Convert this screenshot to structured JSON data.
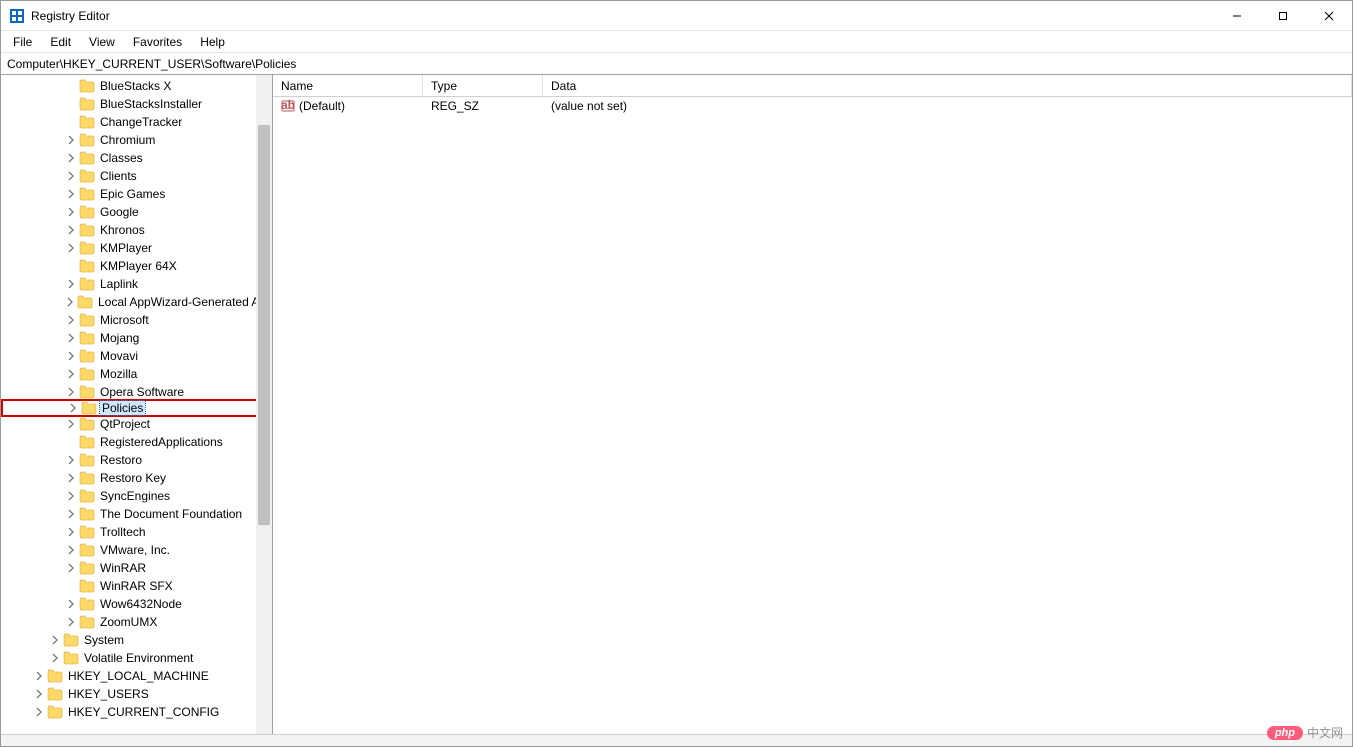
{
  "window": {
    "title": "Registry Editor"
  },
  "menu": {
    "file": "File",
    "edit": "Edit",
    "view": "View",
    "favorites": "Favorites",
    "help": "Help"
  },
  "address": "Computer\\HKEY_CURRENT_USER\\Software\\Policies",
  "tree": {
    "items": [
      {
        "indent": 4,
        "chev": "none",
        "label": "BlueStacks X"
      },
      {
        "indent": 4,
        "chev": "none",
        "label": "BlueStacksInstaller"
      },
      {
        "indent": 4,
        "chev": "none",
        "label": "ChangeTracker"
      },
      {
        "indent": 4,
        "chev": "right",
        "label": "Chromium"
      },
      {
        "indent": 4,
        "chev": "right",
        "label": "Classes"
      },
      {
        "indent": 4,
        "chev": "right",
        "label": "Clients"
      },
      {
        "indent": 4,
        "chev": "right",
        "label": "Epic Games"
      },
      {
        "indent": 4,
        "chev": "right",
        "label": "Google"
      },
      {
        "indent": 4,
        "chev": "right",
        "label": "Khronos"
      },
      {
        "indent": 4,
        "chev": "right",
        "label": "KMPlayer"
      },
      {
        "indent": 4,
        "chev": "none",
        "label": "KMPlayer 64X"
      },
      {
        "indent": 4,
        "chev": "right",
        "label": "Laplink"
      },
      {
        "indent": 4,
        "chev": "right",
        "label": "Local AppWizard-Generated Applications"
      },
      {
        "indent": 4,
        "chev": "right",
        "label": "Microsoft"
      },
      {
        "indent": 4,
        "chev": "right",
        "label": "Mojang"
      },
      {
        "indent": 4,
        "chev": "right",
        "label": "Movavi"
      },
      {
        "indent": 4,
        "chev": "right",
        "label": "Mozilla"
      },
      {
        "indent": 4,
        "chev": "right",
        "label": "Opera Software"
      },
      {
        "indent": 4,
        "chev": "right",
        "label": "Policies",
        "selected": true,
        "highlighted": true
      },
      {
        "indent": 4,
        "chev": "right",
        "label": "QtProject"
      },
      {
        "indent": 4,
        "chev": "none",
        "label": "RegisteredApplications"
      },
      {
        "indent": 4,
        "chev": "right",
        "label": "Restoro"
      },
      {
        "indent": 4,
        "chev": "right",
        "label": "Restoro Key"
      },
      {
        "indent": 4,
        "chev": "right",
        "label": "SyncEngines"
      },
      {
        "indent": 4,
        "chev": "right",
        "label": "The Document Foundation"
      },
      {
        "indent": 4,
        "chev": "right",
        "label": "Trolltech"
      },
      {
        "indent": 4,
        "chev": "right",
        "label": "VMware, Inc."
      },
      {
        "indent": 4,
        "chev": "right",
        "label": "WinRAR"
      },
      {
        "indent": 4,
        "chev": "none",
        "label": "WinRAR SFX"
      },
      {
        "indent": 4,
        "chev": "right",
        "label": "Wow6432Node"
      },
      {
        "indent": 4,
        "chev": "right",
        "label": "ZoomUMX"
      },
      {
        "indent": 3,
        "chev": "right",
        "label": "System"
      },
      {
        "indent": 3,
        "chev": "right",
        "label": "Volatile Environment"
      },
      {
        "indent": 2,
        "chev": "right",
        "label": "HKEY_LOCAL_MACHINE"
      },
      {
        "indent": 2,
        "chev": "right",
        "label": "HKEY_USERS"
      },
      {
        "indent": 2,
        "chev": "right",
        "label": "HKEY_CURRENT_CONFIG"
      }
    ]
  },
  "list": {
    "headers": {
      "name": "Name",
      "type": "Type",
      "data": "Data"
    },
    "rows": [
      {
        "name": "(Default)",
        "type": "REG_SZ",
        "data": "(value not set)"
      }
    ]
  },
  "watermark": {
    "pill": "php",
    "text": "中文网"
  }
}
